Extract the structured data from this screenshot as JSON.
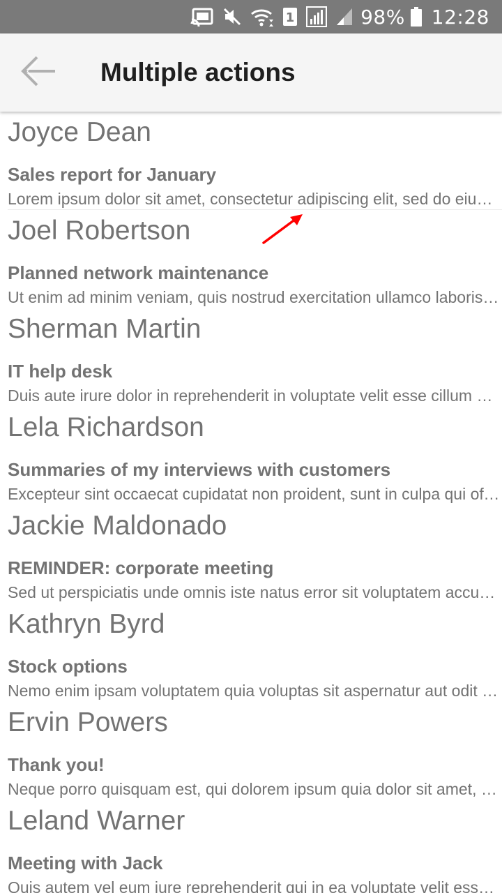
{
  "status_bar": {
    "battery_percent": "98%",
    "time": "12:28",
    "sim_slot": "1",
    "icons": [
      "cast-icon",
      "mute-icon",
      "wifi-icon",
      "sim-1-icon",
      "signal-icon",
      "signal-weak-icon",
      "battery-icon"
    ]
  },
  "app_bar": {
    "back_icon": "arrow-left-icon",
    "title": "Multiple actions"
  },
  "messages": [
    {
      "sender": "Joyce Dean",
      "subject": "Sales report for January",
      "preview": "Lorem ipsum dolor sit amet, consectetur adipiscing elit, sed do eiusmod tempor incididunt ut labore et dolore magna aliqua."
    },
    {
      "sender": "Joel Robertson",
      "subject": "Planned network maintenance",
      "preview": "Ut enim ad minim veniam, quis nostrud exercitation ullamco laboris nisi ut aliquip ex ea commodo consequat."
    },
    {
      "sender": "Sherman Martin",
      "subject": "IT help desk",
      "preview": "Duis aute irure dolor in reprehenderit in voluptate velit esse cillum dolore eu fugiat nulla pariatur."
    },
    {
      "sender": "Lela Richardson",
      "subject": "Summaries of my interviews with customers",
      "preview": "Excepteur sint occaecat cupidatat non proident, sunt in culpa qui officia deserunt mollit anim id est laborum."
    },
    {
      "sender": "Jackie Maldonado",
      "subject": "REMINDER: corporate meeting",
      "preview": "Sed ut perspiciatis unde omnis iste natus error sit voluptatem accusantium doloremque laudantium."
    },
    {
      "sender": "Kathryn Byrd",
      "subject": "Stock options",
      "preview": "Nemo enim ipsam voluptatem quia voluptas sit aspernatur aut odit aut fugit, sed quia consequuntur magni dolores."
    },
    {
      "sender": "Ervin Powers",
      "subject": "Thank you!",
      "preview": "Neque porro quisquam est, qui dolorem ipsum quia dolor sit amet, consectetur, adipisci velit."
    },
    {
      "sender": "Leland Warner",
      "subject": "Meeting with Jack",
      "preview": "Quis autem vel eum iure reprehenderit qui in ea voluptate velit esse quam nihil molestiae consequatur."
    }
  ],
  "colors": {
    "status_bar_bg": "#7a7a7a",
    "app_bar_bg": "#f5f5f5",
    "text_gray": "#737373",
    "title_text": "#1f1f1f",
    "annotation_arrow": "#ff0000"
  }
}
